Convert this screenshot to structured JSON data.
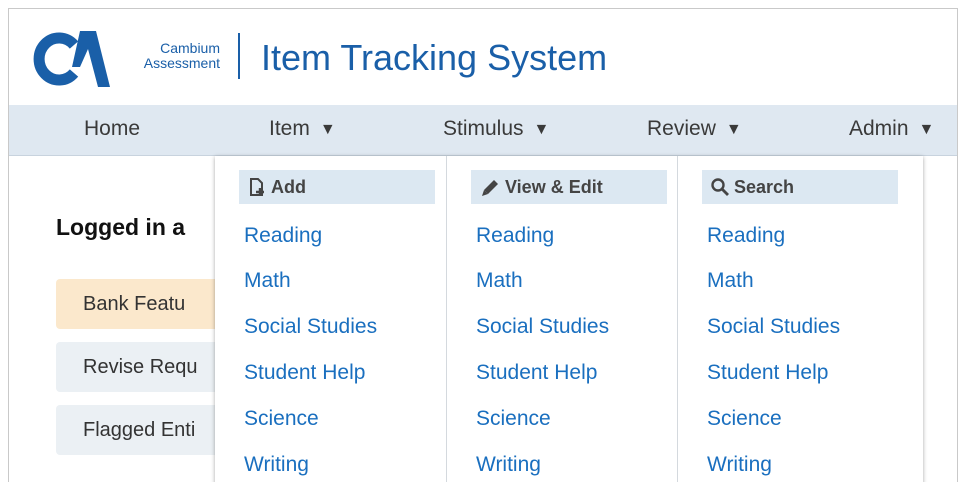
{
  "brand": {
    "logo_line1": "Cambium",
    "logo_line2": "Assessment",
    "app_title": "Item Tracking System",
    "logo_color": "#1a5fa8"
  },
  "nav": {
    "items": [
      {
        "label": "Home",
        "has_caret": false
      },
      {
        "label": "Item",
        "has_caret": true
      },
      {
        "label": "Stimulus",
        "has_caret": true
      },
      {
        "label": "Review",
        "has_caret": true
      },
      {
        "label": "Admin",
        "has_caret": true
      }
    ]
  },
  "main": {
    "logged_in": "Logged in a",
    "buttons": [
      {
        "label": "Bank Featu",
        "color": "#fbe8cc"
      },
      {
        "label": "Revise Requ",
        "color": "#ebf0f4"
      },
      {
        "label": "Flagged Enti",
        "color": "#ebf0f4"
      }
    ]
  },
  "dropdown": {
    "columns": [
      {
        "header": "Add",
        "icon": "add-document-icon",
        "links": [
          "Reading",
          "Math",
          "Social Studies",
          "Student Help",
          "Science",
          "Writing"
        ]
      },
      {
        "header": "View & Edit",
        "icon": "pencil-icon",
        "links": [
          "Reading",
          "Math",
          "Social Studies",
          "Student Help",
          "Science",
          "Writing"
        ]
      },
      {
        "header": "Search",
        "icon": "search-icon",
        "links": [
          "Reading",
          "Math",
          "Social Studies",
          "Student Help",
          "Science",
          "Writing"
        ]
      }
    ]
  },
  "colors": {
    "link": "#1a6fbf",
    "navbar_bg": "#dfe8f1",
    "column_header_bg": "#dce8f2"
  }
}
